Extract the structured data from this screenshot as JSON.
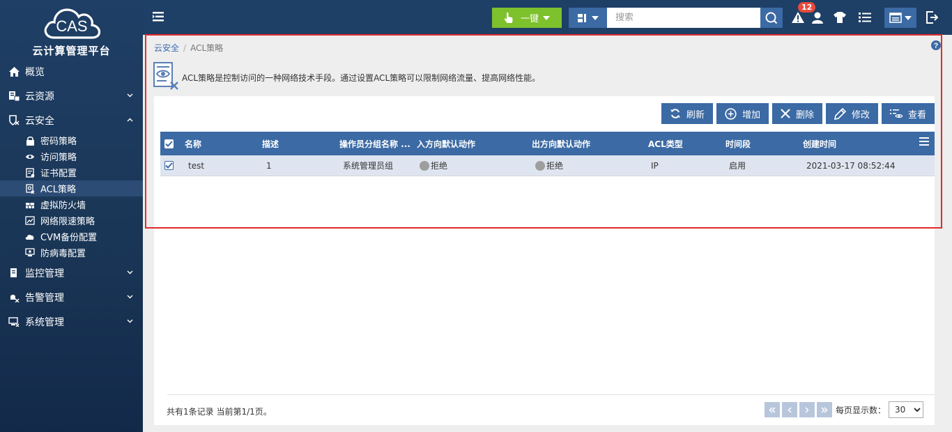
{
  "app": {
    "logo_text": "CAS",
    "title": "云计算管理平台"
  },
  "sidebar": {
    "items": [
      {
        "label": "概览",
        "icon": "home-icon"
      },
      {
        "label": "云资源",
        "icon": "server-icon",
        "expanded": false
      },
      {
        "label": "云安全",
        "icon": "shield-icon",
        "expanded": true
      },
      {
        "label": "监控管理",
        "icon": "monitor-icon",
        "expanded": false
      },
      {
        "label": "告警管理",
        "icon": "bell-icon",
        "expanded": false
      },
      {
        "label": "系统管理",
        "icon": "computer-icon",
        "expanded": false
      }
    ],
    "subitems": [
      {
        "label": "密码策略",
        "icon": "lock-icon"
      },
      {
        "label": "访问策略",
        "icon": "eye-icon"
      },
      {
        "label": "证书配置",
        "icon": "certificate-icon"
      },
      {
        "label": "ACL策略",
        "icon": "acl-icon",
        "active": true
      },
      {
        "label": "虚拟防火墙",
        "icon": "firewall-icon"
      },
      {
        "label": "网络限速策略",
        "icon": "speed-icon"
      },
      {
        "label": "CVM备份配置",
        "icon": "backup-icon"
      },
      {
        "label": "防病毒配置",
        "icon": "antivirus-icon"
      }
    ]
  },
  "topbar": {
    "onekey_label": "一键",
    "search_placeholder": "搜索",
    "alert_count": "12"
  },
  "breadcrumb": {
    "parent": "云安全",
    "separator": "/",
    "current": "ACL策略"
  },
  "intro": {
    "text": "ACL策略是控制访问的一种网络技术手段。通过设置ACL策略可以限制网络流量、提高网络性能。"
  },
  "toolbar": {
    "refresh": "刷新",
    "add": "增加",
    "delete": "删除",
    "edit": "修改",
    "view": "查看"
  },
  "table": {
    "columns": [
      "名称",
      "描述",
      "操作员分组名称 ...",
      "入方向默认动作",
      "出方向默认动作",
      "ACL类型",
      "时间段",
      "创建时间"
    ],
    "rows": [
      {
        "checked": true,
        "name": "test",
        "desc": "1",
        "group": "系统管理员组",
        "in_action": "拒绝",
        "out_action": "拒绝",
        "acl_type": "IP",
        "time": "启用",
        "created": "2021-03-17 08:52:44"
      }
    ]
  },
  "footer": {
    "summary": "共有1条记录 当前第1/1页。",
    "page_size_label": "每页显示数：",
    "page_size": "30"
  },
  "colors": {
    "sidebar_bg": "#1f3f66",
    "topbar_bg": "#1e3f66",
    "primary": "#3b6aa4",
    "onekey_green": "#7dc12d",
    "badge_red": "#e84a3c",
    "highlight_red": "#e02b2b"
  }
}
